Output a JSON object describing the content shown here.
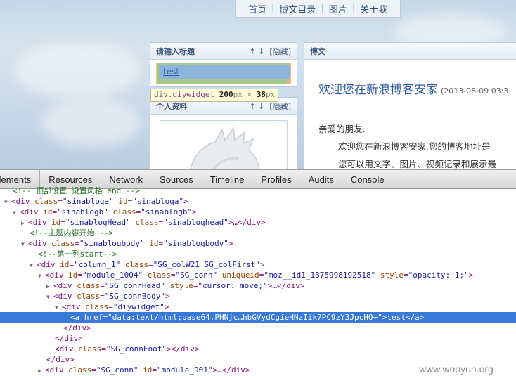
{
  "nav": {
    "items": [
      "首页",
      "博文目录",
      "图片",
      "关于我"
    ]
  },
  "left_panel": {
    "title": "请输入标题",
    "arrows": "↑ ↓",
    "hide": "[隐藏]",
    "link_text": "test"
  },
  "tooltip": {
    "selector": "div.diywidget",
    "w": "200",
    "x": " × ",
    "h": "38",
    "unit": "px"
  },
  "profile_panel": {
    "title": "个人资料",
    "arrows": "↑ ↓",
    "hide": "[隐藏]"
  },
  "post_panel": {
    "title": "博文",
    "post_title": "欢迎您在新浪博客安家",
    "post_date": "(2013-08-09 03:3",
    "greeting": "亲爱的朋友:",
    "line1": "欢迎您在新浪博客安家,您的博客地址是",
    "line2": "您可以用文字、图片、视频记录和展示最"
  },
  "devtools": {
    "tabs": [
      "Elements",
      "Resources",
      "Network",
      "Sources",
      "Timeline",
      "Profiles",
      "Audits",
      "Console"
    ],
    "active_tab": "Elements"
  },
  "dom": {
    "r0": "<!-- 顶部设置 设置风格 end -->",
    "r1_tag": "<div ",
    "r1_a1": "class",
    "r1_v1": "\"sinabloga\"",
    "r1_a2": "id",
    "r1_v2": "\"sinabloga\"",
    "r2_a1": "id",
    "r2_v1": "\"sinablogb\"",
    "r2_a2": "class",
    "r2_v2": "\"sinablogb\"",
    "r3_a1": "id",
    "r3_v1": "\"sinablogHead\"",
    "r3_a2": "class",
    "r3_v2": "\"sinabloghead\"",
    "r4": "<!--主题内容开始 -->",
    "r5_a1": "class",
    "r5_v1": "\"sinablogbody\"",
    "r5_a2": "id",
    "r5_v2": "\"sinablogbody\"",
    "r6": "<!--第一列start-->",
    "r7_a1": "id",
    "r7_v1": "\"column_1\"",
    "r7_a2": "class",
    "r7_v2": "\"SG_colW21 SG_colFirst\"",
    "r8_a1": "id",
    "r8_v1": "\"module_1004\"",
    "r8_a2": "class",
    "r8_v2": "\"SG_conn\"",
    "r8_a3": "uniqueid",
    "r8_v3": "\"moz__id1_1375998192518\"",
    "r8_a4": "style",
    "r8_v4": "\"opacity: 1;\"",
    "r9_a1": "class",
    "r9_v1": "\"SG_connHead\"",
    "r9_a2": "style",
    "r9_v2": "\"cursor: move;\"",
    "r10_a1": "class",
    "r10_v1": "\"SG_connBody\"",
    "r11_a1": "class",
    "r11_v1": "\"diywidget\"",
    "r12_a1": "href",
    "r12_v1": "\"data:text/html;base64,PHNjc…hbGVydCgieHNzIik7PC9zY3JpcHQ+\"",
    "r12_text": "test",
    "r13": "</div>",
    "r14": "</div>",
    "r15_a1": "class",
    "r15_v1": "\"SG_connFoot\"",
    "r16": "</div>",
    "r17_a1": "class",
    "r17_v1": "\"SG_conn\"",
    "r17_a2": "id",
    "r17_v2": "\"module_901\""
  },
  "watermark": "www.wooyun.org"
}
